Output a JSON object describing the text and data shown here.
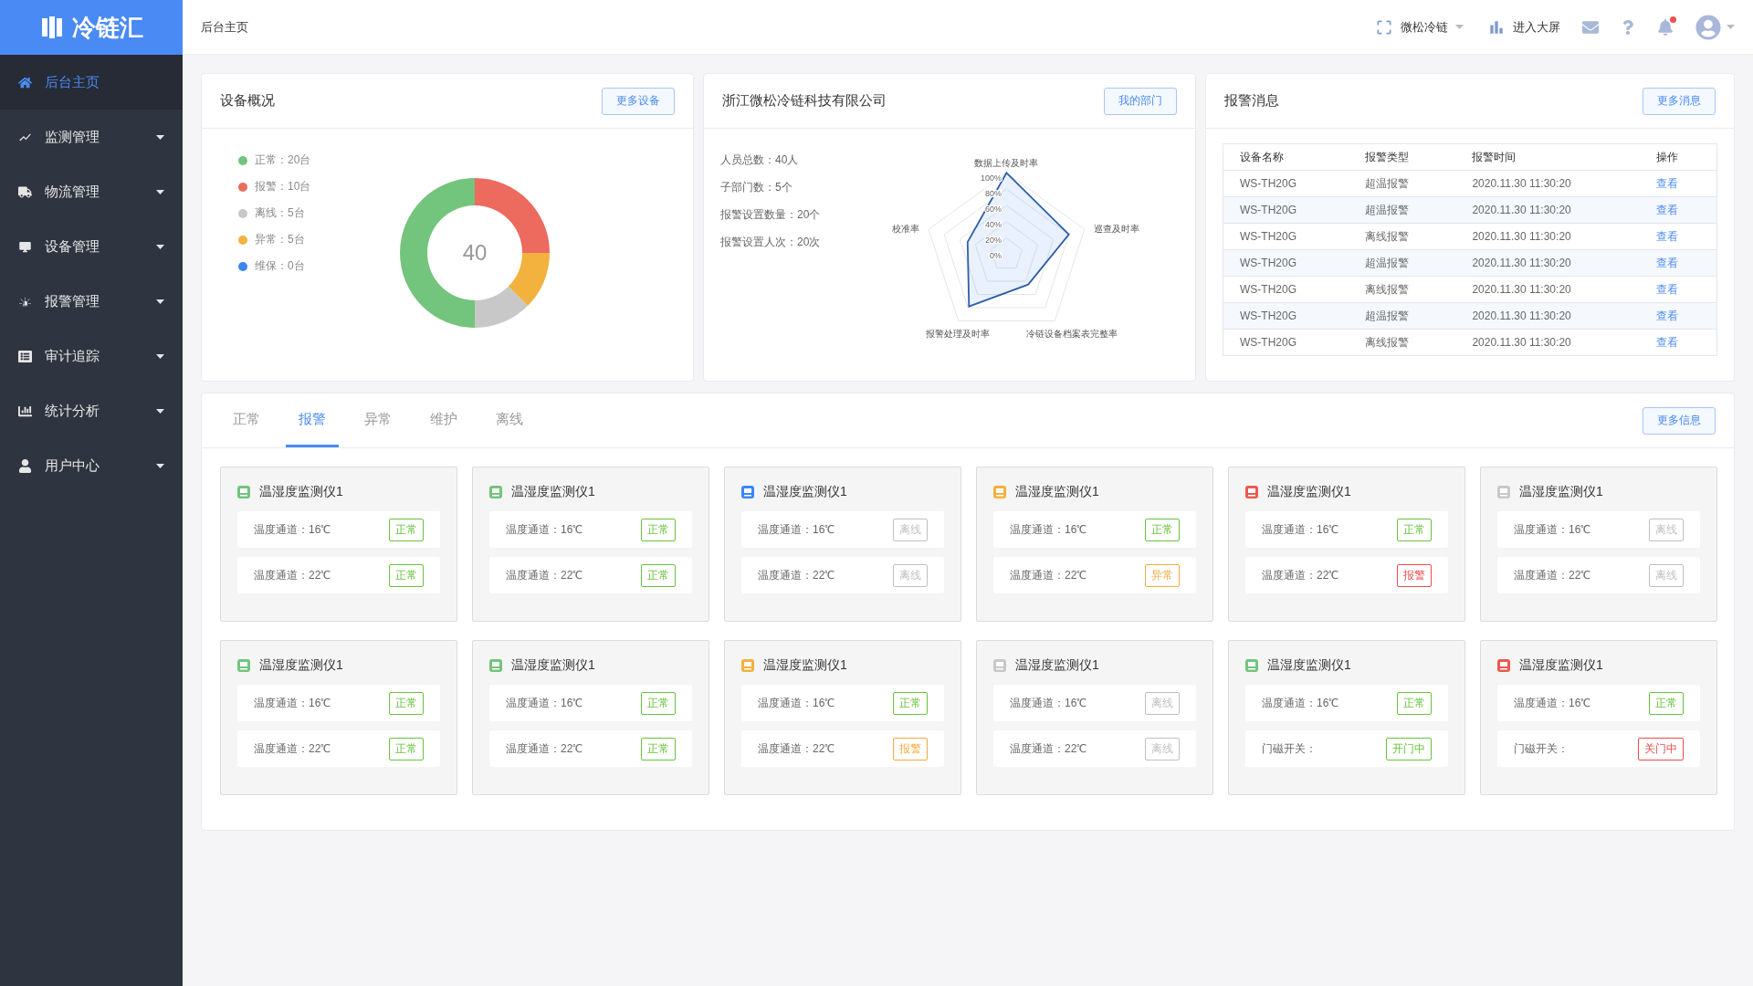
{
  "logo": {
    "text": "冷链汇"
  },
  "sidebar": {
    "items": [
      {
        "label": "后台主页",
        "selected": true,
        "has_submenu": false
      },
      {
        "label": "监测管理",
        "selected": false,
        "has_submenu": true
      },
      {
        "label": "物流管理",
        "selected": false,
        "has_submenu": true
      },
      {
        "label": "设备管理",
        "selected": false,
        "has_submenu": true
      },
      {
        "label": "报警管理",
        "selected": false,
        "has_submenu": true
      },
      {
        "label": "审计追踪",
        "selected": false,
        "has_submenu": true
      },
      {
        "label": "统计分析",
        "selected": false,
        "has_submenu": true
      },
      {
        "label": "用户中心",
        "selected": false,
        "has_submenu": true
      }
    ]
  },
  "header": {
    "breadcrumb": "后台主页",
    "org_switcher": "微松冷链",
    "big_screen": "进入大屏",
    "notification_unread": true
  },
  "device_overview": {
    "title": "设备概况",
    "button": "更多设备",
    "center_label": "40",
    "legend": [
      {
        "text": "正常：20台",
        "color": "#73c47c"
      },
      {
        "text": "报警：10台",
        "color": "#ec6a5e"
      },
      {
        "text": "离线：5台",
        "color": "#c8c8c8"
      },
      {
        "text": "异常：5台",
        "color": "#f3b13e"
      },
      {
        "text": "维保：0台",
        "color": "#3b86f7"
      }
    ],
    "chart_data": {
      "type": "donut",
      "values": [
        50,
        25,
        12.5,
        12.5,
        0
      ]
    }
  },
  "company": {
    "title": "浙江微松冷链科技有限公司",
    "button": "我的部门",
    "stats": [
      "人员总数：40人",
      "子部门数：5个",
      "报警设置数量：20个",
      "报警设置人次：20次"
    ],
    "radar": {
      "axes": [
        "数据上传及时率",
        "校准率",
        "巡查及时率",
        "报警处理及时率",
        "冷链设备档案表完整率"
      ],
      "ticks": [
        "100%",
        "80%",
        "60%",
        "40%",
        "20%",
        "0%"
      ]
    }
  },
  "alarms": {
    "title": "报警消息",
    "button": "更多消息",
    "columns": [
      "设备名称",
      "报警类型",
      "报警时间",
      "操作"
    ],
    "rows": [
      [
        "WS-TH20G",
        "超温报警",
        "2020.11.30 11:30:20",
        "查看"
      ],
      [
        "WS-TH20G",
        "超温报警",
        "2020.11.30 11:30:20",
        "查看"
      ],
      [
        "WS-TH20G",
        "离线报警",
        "2020.11.30 11:30:20",
        "查看"
      ],
      [
        "WS-TH20G",
        "超温报警",
        "2020.11.30 11:30:20",
        "查看"
      ],
      [
        "WS-TH20G",
        "离线报警",
        "2020.11.30 11:30:20",
        "查看"
      ],
      [
        "WS-TH20G",
        "超温报警",
        "2020.11.30 11:30:20",
        "查看"
      ],
      [
        "WS-TH20G",
        "离线报警",
        "2020.11.30 11:30:20",
        "查看"
      ]
    ]
  },
  "devices": {
    "tabs": [
      {
        "label": "正常",
        "selected": false
      },
      {
        "label": "报警",
        "selected": true
      },
      {
        "label": "异常",
        "selected": false
      },
      {
        "label": "维护",
        "selected": false
      },
      {
        "label": "离线",
        "selected": false
      }
    ],
    "button": "更多信息",
    "cards": [
      {
        "name": "温湿度监测仪1",
        "color": "#73c47c",
        "rows": [
          {
            "label": "温度通道：16℃",
            "tag": "正常",
            "color": "#67c23a"
          },
          {
            "label": "温度通道：22℃",
            "tag": "正常",
            "color": "#67c23a"
          }
        ]
      },
      {
        "name": "温湿度监测仪1",
        "color": "#73c47c",
        "rows": [
          {
            "label": "温度通道：16℃",
            "tag": "正常",
            "color": "#67c23a"
          },
          {
            "label": "温度通道：22℃",
            "tag": "正常",
            "color": "#67c23a"
          }
        ]
      },
      {
        "name": "温湿度监测仪1",
        "color": "#3b86f7",
        "rows": [
          {
            "label": "温度通道：16℃",
            "tag": "离线",
            "color": "#c0c0c0"
          },
          {
            "label": "温度通道：22℃",
            "tag": "离线",
            "color": "#c0c0c0"
          }
        ]
      },
      {
        "name": "温湿度监测仪1",
        "color": "#f3b13e",
        "rows": [
          {
            "label": "温度通道：16℃",
            "tag": "正常",
            "color": "#67c23a"
          },
          {
            "label": "温度通道：22℃",
            "tag": "异常",
            "color": "#f3a93e"
          }
        ]
      },
      {
        "name": "温湿度监测仪1",
        "color": "#ec5a4e",
        "rows": [
          {
            "label": "温度通道：16℃",
            "tag": "正常",
            "color": "#67c23a"
          },
          {
            "label": "温度通道：22℃",
            "tag": "报警",
            "color": "#ee4b4b"
          }
        ]
      },
      {
        "name": "温湿度监测仪1",
        "color": "#c8c8c8",
        "rows": [
          {
            "label": "温度通道：16℃",
            "tag": "离线",
            "color": "#c0c0c0"
          },
          {
            "label": "温度通道：22℃",
            "tag": "离线",
            "color": "#c0c0c0"
          }
        ]
      },
      {
        "name": "温湿度监测仪1",
        "color": "#73c47c",
        "rows": [
          {
            "label": "温度通道：16℃",
            "tag": "正常",
            "color": "#67c23a"
          },
          {
            "label": "温度通道：22℃",
            "tag": "正常",
            "color": "#67c23a"
          }
        ]
      },
      {
        "name": "温湿度监测仪1",
        "color": "#73c47c",
        "rows": [
          {
            "label": "温度通道：16℃",
            "tag": "正常",
            "color": "#67c23a"
          },
          {
            "label": "温度通道：22℃",
            "tag": "正常",
            "color": "#67c23a"
          }
        ]
      },
      {
        "name": "温湿度监测仪1",
        "color": "#f3b13e",
        "rows": [
          {
            "label": "温度通道：16℃",
            "tag": "正常",
            "color": "#67c23a"
          },
          {
            "label": "温度通道：22℃",
            "tag": "报警",
            "color": "#f3a93e"
          }
        ]
      },
      {
        "name": "温湿度监测仪1",
        "color": "#c8c8c8",
        "rows": [
          {
            "label": "温度通道：16℃",
            "tag": "离线",
            "color": "#c0c0c0"
          },
          {
            "label": "温度通道：22℃",
            "tag": "离线",
            "color": "#c0c0c0"
          }
        ]
      },
      {
        "name": "温湿度监测仪1",
        "color": "#73c47c",
        "rows": [
          {
            "label": "温度通道：16℃",
            "tag": "正常",
            "color": "#67c23a"
          },
          {
            "label": "门磁开关：",
            "tag": "开门中",
            "color": "#67c23a"
          }
        ]
      },
      {
        "name": "温湿度监测仪1",
        "color": "#ec5a4e",
        "rows": [
          {
            "label": "温度通道：16℃",
            "tag": "正常",
            "color": "#67c23a"
          },
          {
            "label": "门磁开关：",
            "tag": "关门中",
            "color": "#ee4b4b"
          }
        ]
      }
    ]
  }
}
